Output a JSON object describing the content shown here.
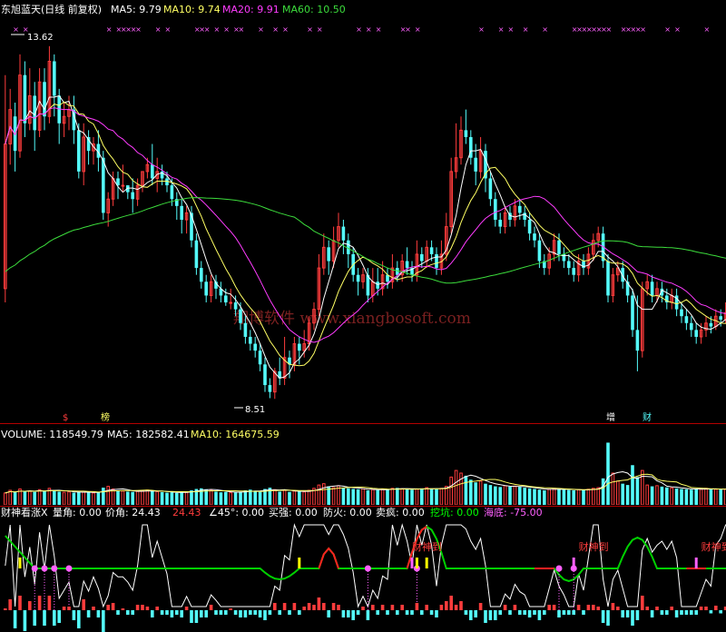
{
  "colors": {
    "up": "#ff3c3c",
    "down": "#54fcfc",
    "ma5": "#ffffff",
    "ma10": "#ffff64",
    "ma20": "#ff3cff",
    "ma60": "#3cdc3c",
    "divider": "#b40000",
    "header_text": "#ffffff",
    "watermark": "#7a2020",
    "green_line": "#00d000",
    "magenta_dot": "#ff60ff"
  },
  "main_panel": {
    "title": "东旭蓝天(日线 前复权)",
    "ma_labels": [
      {
        "name": "MA5",
        "value": "9.79",
        "text": "MA5: 9.79"
      },
      {
        "name": "MA10",
        "value": "9.74",
        "text": "MA10: 9.74"
      },
      {
        "name": "MA20",
        "value": "9.91",
        "text": "MA20: 9.91"
      },
      {
        "name": "MA60",
        "value": "10.50",
        "text": "MA60: 10.50"
      }
    ],
    "high_label": "13.62",
    "low_label": "8.51",
    "watermark": "翔博软件 www.xiangbosoft.com",
    "markers": [
      {
        "text": "$",
        "color": "#ff3c3c"
      },
      {
        "text": "榜",
        "color": "#ffff64"
      },
      {
        "text": "增",
        "color": "#ffffff"
      },
      {
        "text": "财",
        "color": "#54fcfc"
      }
    ]
  },
  "volume_panel": {
    "labels": [
      {
        "text": "VOLUME: 118549.79",
        "color": "#ffffff"
      },
      {
        "text": "MA5: 182582.41",
        "color": "#ffffff"
      },
      {
        "text": "MA10: 164675.59",
        "color": "#ffff64"
      }
    ]
  },
  "indicator_panel": {
    "labels": [
      {
        "text": "财神看涨X",
        "color": "#ffffff"
      },
      {
        "text": "量角: 0.00",
        "color": "#ffffff"
      },
      {
        "text": "价角: 24.43",
        "color": "#ffffff"
      },
      {
        "text": "24.43",
        "color": "#ff3c3c"
      },
      {
        "text": "∠45°: 0.00",
        "color": "#ffffff"
      },
      {
        "text": "买强: 0.00",
        "color": "#ffffff"
      },
      {
        "text": "防火: 0.00",
        "color": "#ffffff"
      },
      {
        "text": "卖疯: 0.00",
        "color": "#ffffff"
      },
      {
        "text": "挖坑: 0.00",
        "color": "#00ff00"
      },
      {
        "text": "海底: -75.00",
        "color": "#ff60ff"
      }
    ],
    "signal_text": "财神到"
  },
  "chart_data": {
    "type": "candlestick",
    "title": "东旭蓝天(日线 前复权)",
    "ylim": [
      8.2,
      14.0
    ],
    "candles": [
      [
        10.1,
        12.2,
        13.2,
        9.9
      ],
      [
        12.2,
        12.7,
        13.0,
        11.9
      ],
      [
        12.6,
        12.1,
        12.8,
        11.8
      ],
      [
        12.1,
        13.2,
        13.5,
        12.0
      ],
      [
        13.2,
        12.5,
        13.4,
        12.3
      ],
      [
        12.5,
        12.9,
        13.3,
        12.4
      ],
      [
        12.9,
        12.4,
        13.1,
        12.1
      ],
      [
        12.4,
        13.1,
        13.3,
        12.3
      ],
      [
        13.1,
        12.6,
        13.3,
        12.4
      ],
      [
        12.6,
        13.4,
        13.62,
        12.5
      ],
      [
        13.4,
        12.9,
        13.5,
        12.6
      ],
      [
        12.9,
        12.5,
        13.0,
        12.2
      ],
      [
        12.5,
        12.6,
        12.8,
        12.3
      ],
      [
        12.6,
        12.7,
        12.9,
        12.4
      ],
      [
        12.7,
        12.4,
        12.9,
        12.2
      ],
      [
        12.4,
        11.8,
        12.5,
        11.7
      ],
      [
        11.8,
        12.3,
        12.5,
        11.6
      ],
      [
        12.3,
        12.1,
        12.4,
        11.9
      ],
      [
        12.1,
        12.2,
        12.3,
        11.9
      ],
      [
        12.2,
        12.0,
        12.4,
        11.8
      ],
      [
        12.0,
        11.2,
        12.1,
        11.1
      ],
      [
        11.2,
        11.4,
        11.5,
        11.0
      ],
      [
        11.4,
        11.7,
        11.8,
        11.3
      ],
      [
        11.7,
        11.6,
        11.8,
        11.4
      ],
      [
        11.6,
        11.6,
        11.9,
        11.5
      ],
      [
        11.6,
        11.5,
        11.6,
        11.4
      ],
      [
        11.5,
        11.4,
        11.7,
        11.2
      ],
      [
        11.4,
        11.6,
        11.7,
        11.3
      ],
      [
        11.6,
        11.8,
        11.8,
        11.5
      ],
      [
        11.8,
        11.9,
        12.0,
        11.7
      ],
      [
        11.9,
        11.7,
        12.2,
        11.6
      ],
      [
        11.7,
        11.8,
        12.0,
        11.5
      ],
      [
        11.8,
        11.7,
        11.9,
        11.6
      ],
      [
        11.7,
        11.6,
        11.8,
        11.5
      ],
      [
        11.6,
        11.4,
        11.7,
        11.3
      ],
      [
        11.4,
        11.3,
        11.5,
        11.1
      ],
      [
        11.3,
        11.1,
        11.4,
        10.9
      ],
      [
        11.1,
        11.2,
        11.3,
        10.9
      ],
      [
        11.2,
        10.8,
        11.3,
        10.7
      ],
      [
        10.8,
        10.4,
        10.9,
        10.3
      ],
      [
        10.4,
        10.2,
        10.5,
        10.1
      ],
      [
        10.2,
        10.0,
        10.3,
        9.9
      ],
      [
        10.0,
        10.2,
        10.3,
        9.9
      ],
      [
        10.2,
        10.1,
        10.3,
        9.95
      ],
      [
        10.1,
        10.0,
        10.2,
        9.9
      ],
      [
        10.0,
        9.9,
        10.1,
        9.85
      ],
      [
        9.9,
        9.9,
        10.1,
        9.8
      ],
      [
        9.9,
        9.8,
        10.0,
        9.7
      ],
      [
        9.8,
        9.6,
        9.9,
        9.5
      ],
      [
        9.6,
        9.4,
        9.7,
        9.3
      ],
      [
        9.4,
        9.3,
        9.5,
        9.2
      ],
      [
        9.3,
        9.2,
        9.4,
        9.1
      ],
      [
        9.2,
        9.0,
        9.3,
        8.9
      ],
      [
        9.0,
        8.7,
        9.1,
        8.6
      ],
      [
        8.7,
        8.6,
        8.8,
        8.51
      ],
      [
        8.6,
        8.9,
        8.95,
        8.5
      ],
      [
        8.9,
        8.8,
        9.1,
        8.7
      ],
      [
        8.8,
        9.1,
        9.4,
        8.7
      ],
      [
        9.1,
        9.0,
        9.2,
        8.8
      ],
      [
        9.0,
        9.3,
        9.4,
        8.9
      ],
      [
        9.3,
        9.2,
        9.4,
        9.0
      ],
      [
        9.2,
        9.3,
        9.5,
        9.1
      ],
      [
        9.3,
        9.6,
        9.7,
        9.2
      ],
      [
        9.6,
        9.8,
        9.9,
        9.5
      ],
      [
        9.8,
        10.4,
        10.6,
        9.7
      ],
      [
        10.4,
        10.7,
        10.9,
        10.3
      ],
      [
        10.7,
        10.5,
        10.8,
        10.3
      ],
      [
        10.5,
        10.8,
        11.0,
        10.4
      ],
      [
        10.8,
        11.0,
        11.2,
        10.7
      ],
      [
        11.0,
        10.8,
        11.1,
        10.6
      ],
      [
        10.8,
        10.6,
        10.9,
        10.4
      ],
      [
        10.6,
        10.3,
        10.7,
        10.2
      ],
      [
        10.3,
        10.2,
        10.4,
        10.0
      ],
      [
        10.2,
        10.3,
        10.4,
        10.1
      ],
      [
        10.3,
        10.0,
        10.4,
        9.9
      ],
      [
        10.0,
        10.2,
        10.4,
        9.9
      ],
      [
        10.2,
        10.1,
        10.4,
        10.0
      ],
      [
        10.1,
        10.3,
        10.5,
        10.0
      ],
      [
        10.3,
        10.2,
        10.4,
        10.1
      ],
      [
        10.2,
        10.4,
        10.6,
        10.1
      ],
      [
        10.4,
        10.3,
        10.5,
        10.2
      ],
      [
        10.3,
        10.5,
        10.6,
        10.2
      ],
      [
        10.5,
        10.4,
        10.7,
        10.3
      ],
      [
        10.4,
        10.3,
        10.5,
        10.2
      ],
      [
        10.3,
        10.6,
        10.8,
        10.2
      ],
      [
        10.6,
        10.5,
        10.7,
        10.4
      ],
      [
        10.5,
        10.7,
        10.8,
        10.4
      ],
      [
        10.7,
        10.6,
        10.8,
        10.5
      ],
      [
        10.6,
        10.4,
        10.7,
        10.3
      ],
      [
        10.4,
        10.6,
        10.8,
        10.3
      ],
      [
        10.6,
        11.0,
        11.2,
        10.5
      ],
      [
        11.0,
        11.8,
        12.0,
        10.9
      ],
      [
        11.8,
        12.0,
        12.5,
        11.7
      ],
      [
        12.0,
        12.4,
        12.6,
        11.9
      ],
      [
        12.4,
        12.3,
        12.7,
        12.2
      ],
      [
        12.3,
        12.0,
        12.4,
        11.9
      ],
      [
        12.0,
        11.8,
        12.2,
        11.6
      ],
      [
        11.8,
        12.1,
        12.3,
        11.7
      ],
      [
        12.1,
        11.7,
        12.2,
        11.5
      ],
      [
        11.7,
        11.4,
        11.8,
        11.3
      ],
      [
        11.4,
        11.1,
        11.5,
        11.0
      ],
      [
        11.1,
        11.0,
        11.2,
        10.9
      ],
      [
        11.0,
        11.2,
        11.3,
        10.9
      ],
      [
        11.2,
        11.1,
        11.3,
        11.0
      ],
      [
        11.1,
        11.3,
        11.4,
        11.0
      ],
      [
        11.3,
        11.2,
        11.4,
        11.1
      ],
      [
        11.2,
        11.1,
        11.3,
        11.0
      ],
      [
        11.1,
        10.9,
        11.2,
        10.8
      ],
      [
        10.9,
        10.8,
        11.0,
        10.7
      ],
      [
        10.8,
        10.5,
        10.9,
        10.4
      ],
      [
        10.5,
        10.4,
        10.6,
        10.3
      ],
      [
        10.4,
        10.6,
        10.7,
        10.3
      ],
      [
        10.6,
        10.8,
        10.9,
        10.5
      ],
      [
        10.8,
        10.6,
        10.9,
        10.5
      ],
      [
        10.6,
        10.5,
        10.7,
        10.4
      ],
      [
        10.5,
        10.4,
        10.6,
        10.3
      ],
      [
        10.4,
        10.3,
        10.5,
        10.2
      ],
      [
        10.3,
        10.5,
        10.6,
        10.2
      ],
      [
        10.5,
        10.4,
        10.6,
        10.3
      ],
      [
        10.4,
        10.6,
        10.7,
        10.3
      ],
      [
        10.6,
        10.8,
        10.9,
        10.5
      ],
      [
        10.8,
        10.9,
        11.0,
        10.7
      ],
      [
        10.9,
        10.5,
        11.0,
        10.4
      ],
      [
        10.5,
        10.0,
        10.6,
        9.9
      ],
      [
        10.0,
        10.3,
        10.4,
        9.9
      ],
      [
        10.3,
        10.4,
        10.5,
        10.2
      ],
      [
        10.4,
        10.2,
        10.5,
        10.1
      ],
      [
        10.2,
        10.0,
        10.3,
        9.9
      ],
      [
        10.0,
        9.5,
        10.1,
        9.4
      ],
      [
        9.5,
        9.2,
        10.0,
        8.9
      ],
      [
        9.2,
        10.1,
        10.2,
        9.1
      ],
      [
        10.1,
        10.2,
        10.3,
        10.0
      ],
      [
        10.2,
        10.0,
        10.3,
        9.9
      ],
      [
        10.0,
        10.1,
        10.2,
        9.9
      ],
      [
        10.1,
        10.0,
        10.2,
        9.9
      ],
      [
        10.0,
        9.9,
        10.1,
        9.8
      ],
      [
        9.9,
        10.0,
        10.1,
        9.8
      ],
      [
        10.0,
        9.8,
        10.1,
        9.7
      ],
      [
        9.8,
        9.7,
        9.9,
        9.6
      ],
      [
        9.7,
        9.6,
        9.8,
        9.5
      ],
      [
        9.6,
        9.5,
        9.7,
        9.4
      ],
      [
        9.5,
        9.4,
        9.6,
        9.3
      ],
      [
        9.4,
        9.5,
        9.6,
        9.3
      ],
      [
        9.5,
        9.6,
        9.7,
        9.4
      ],
      [
        9.6,
        9.55,
        9.7,
        9.45
      ],
      [
        9.55,
        9.7,
        9.8,
        9.5
      ],
      [
        9.7,
        9.65,
        9.8,
        9.55
      ],
      [
        9.65,
        9.75,
        9.9,
        9.6
      ],
      [
        9.75,
        9.8,
        10.0,
        9.65
      ]
    ],
    "volume": [
      90,
      110,
      95,
      120,
      100,
      105,
      98,
      115,
      102,
      125,
      110,
      100,
      95,
      98,
      92,
      100,
      96,
      94,
      90,
      93,
      130,
      140,
      120,
      110,
      105,
      100,
      98,
      102,
      108,
      112,
      104,
      100,
      96,
      92,
      95,
      90,
      100,
      96,
      110,
      120,
      125,
      118,
      110,
      100,
      95,
      98,
      92,
      94,
      100,
      110,
      115,
      105,
      98,
      120,
      130,
      115,
      100,
      110,
      98,
      105,
      100,
      98,
      110,
      125,
      150,
      160,
      140,
      130,
      145,
      130,
      125,
      120,
      118,
      122,
      110,
      115,
      112,
      118,
      120,
      125,
      128,
      122,
      118,
      115,
      120,
      125,
      130,
      120,
      118,
      125,
      140,
      210,
      260,
      240,
      220,
      190,
      170,
      180,
      160,
      150,
      140,
      135,
      145,
      138,
      142,
      136,
      130,
      125,
      120,
      115,
      110,
      118,
      125,
      120,
      115,
      112,
      110,
      116,
      112,
      118,
      125,
      130,
      200,
      470,
      240,
      180,
      160,
      150,
      300,
      210,
      260,
      150,
      140,
      145,
      138,
      132,
      128,
      124,
      120,
      118,
      115,
      122,
      118,
      125,
      120,
      118,
      116,
      119,
      121
    ]
  }
}
